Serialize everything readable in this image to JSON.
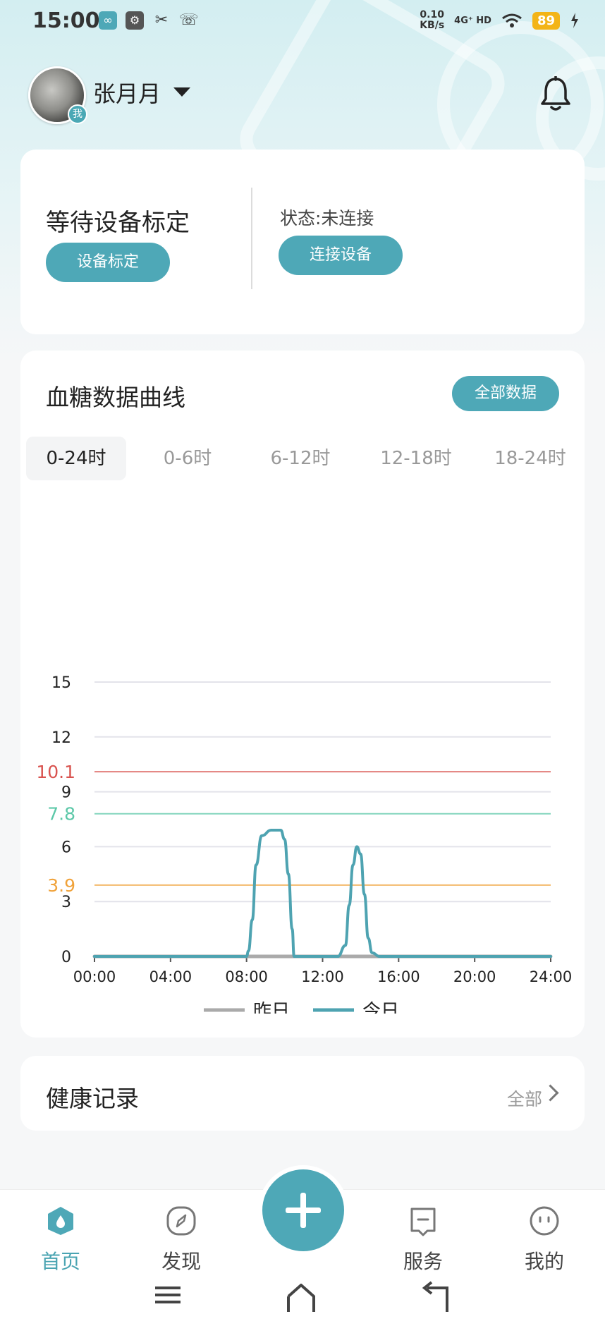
{
  "status_bar": {
    "time": "15:00",
    "net_speed_value": "0.10",
    "net_speed_unit": "KB/s",
    "signal": "4G⁺ HD",
    "battery": "89",
    "notif_icons": [
      "infinity-icon",
      "usb-icon",
      "tools-icon",
      "missed-call-icon"
    ]
  },
  "header": {
    "username": "张月月",
    "avatar_badge": "我"
  },
  "device_card": {
    "title": "等待设备标定",
    "calibrate_label": "设备标定",
    "status": "状态:未连接",
    "connect_label": "连接设备"
  },
  "chart_card": {
    "title": "血糖数据曲线",
    "all_data_label": "全部数据",
    "tabs": [
      "0-24时",
      "0-6时",
      "6-12时",
      "12-18时",
      "18-24时"
    ],
    "active_tab": 0
  },
  "chart_data": {
    "type": "line",
    "x_ticks": [
      "00:00",
      "04:00",
      "08:00",
      "12:00",
      "16:00",
      "20:00",
      "24:00"
    ],
    "y_ticks": [
      0,
      3,
      6,
      9,
      12,
      15
    ],
    "xlim": [
      0,
      24
    ],
    "ylim": [
      0,
      15
    ],
    "reference_lines": [
      {
        "value": 10.1,
        "label": "10.1",
        "color": "#d9534f"
      },
      {
        "value": 7.8,
        "label": "7.8",
        "color": "#5cc8a8"
      },
      {
        "value": 3.9,
        "label": "3.9",
        "color": "#f0a23a"
      }
    ],
    "series": [
      {
        "name": "昨日",
        "color": "#aaaaaa",
        "x": [
          0,
          24
        ],
        "y": [
          0,
          0
        ]
      },
      {
        "name": "今日",
        "color": "#4ea3b1",
        "x": [
          0,
          8,
          8.1,
          8.3,
          8.5,
          8.8,
          9.3,
          9.8,
          10.0,
          10.2,
          10.4,
          10.5,
          11.5,
          12.3,
          12.8,
          13.2,
          13.4,
          13.6,
          13.8,
          14.0,
          14.2,
          14.4,
          14.6,
          15.0,
          24
        ],
        "y": [
          0,
          0,
          0.3,
          2.0,
          5.0,
          6.6,
          6.9,
          6.9,
          6.4,
          4.5,
          1.5,
          0,
          0,
          0,
          0,
          0.6,
          2.8,
          5.0,
          6.0,
          5.6,
          3.4,
          1.0,
          0.2,
          0,
          0
        ]
      }
    ]
  },
  "records_card": {
    "title": "健康记录",
    "all_label": "全部"
  },
  "bottom_nav": {
    "items": [
      {
        "label": "首页",
        "icon": "home-drop-icon",
        "active": true
      },
      {
        "label": "发现",
        "icon": "compass-icon",
        "active": false
      },
      {
        "label": "服务",
        "icon": "service-icon",
        "active": false
      },
      {
        "label": "我的",
        "icon": "face-icon",
        "active": false
      }
    ],
    "center_action_icon": "plus-icon"
  },
  "colors": {
    "accent": "#4ea8b7",
    "active_tab_text": "#4aa4b2"
  }
}
